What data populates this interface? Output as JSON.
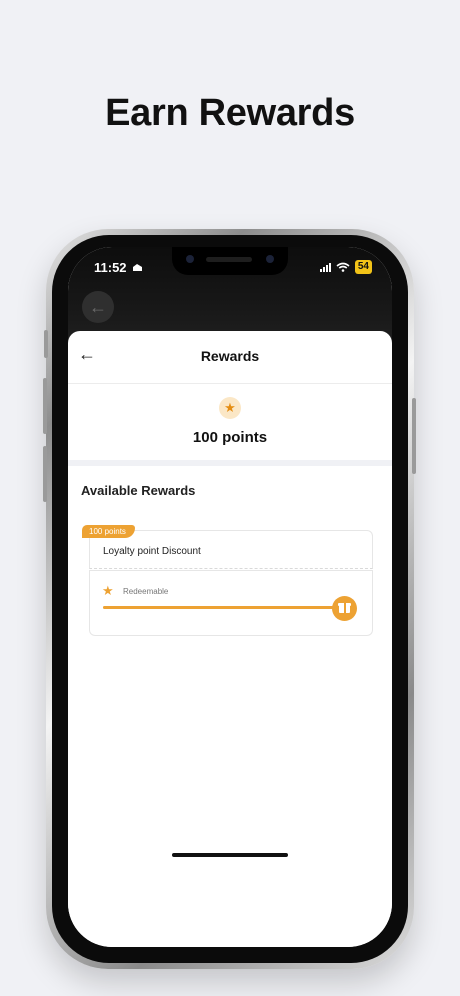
{
  "headline": "Earn Rewards",
  "status_bar": {
    "time": "11:52",
    "battery": "54"
  },
  "header": {
    "title": "Rewards",
    "back_icon": "arrow-left-icon"
  },
  "points_summary": {
    "icon": "star-icon",
    "value": "100 points"
  },
  "available_rewards": {
    "title": "Available Rewards",
    "items": [
      {
        "tag": "100 points",
        "name": "Loyalty point Discount",
        "status_icon": "star-icon",
        "status_label": "Redeemable",
        "progress": 1.0,
        "action_icon": "gift-icon"
      }
    ]
  },
  "colors": {
    "accent": "#eda233",
    "background": "#f0f1f5"
  }
}
